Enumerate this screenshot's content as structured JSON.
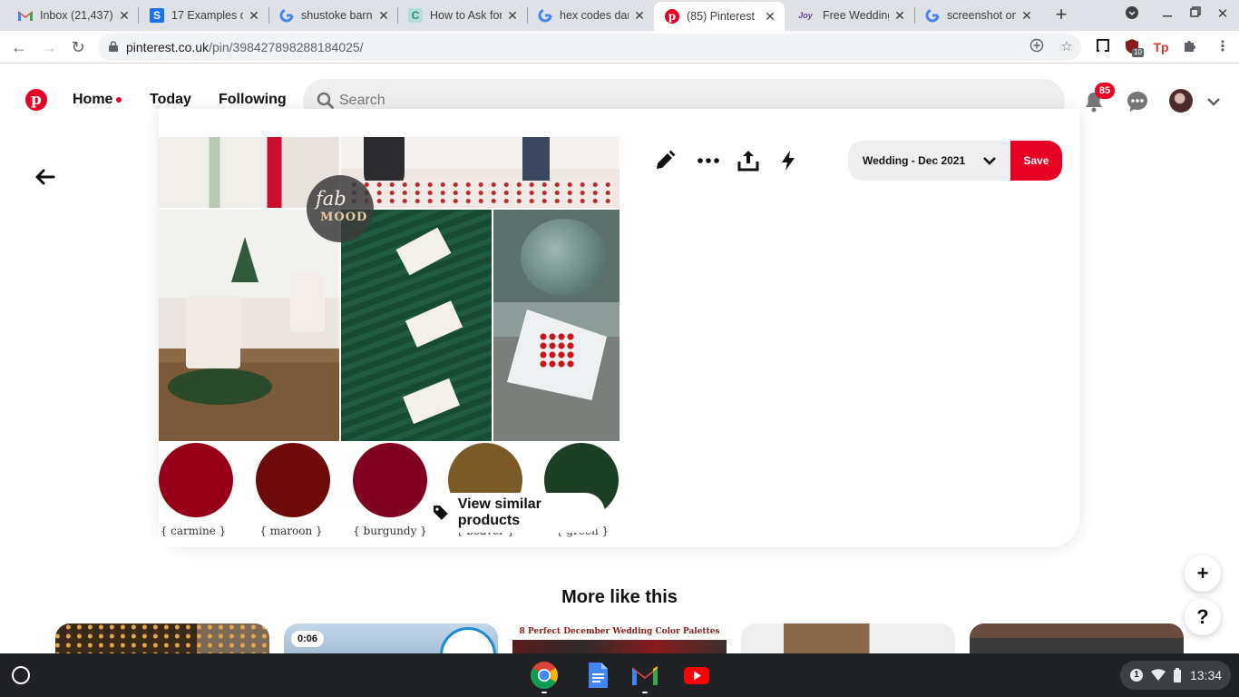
{
  "browser": {
    "tabs": [
      {
        "title": "Inbox (21,437)",
        "favicon": "gmail-icon"
      },
      {
        "title": "17 Examples o",
        "favicon": "s-icon"
      },
      {
        "title": "shustoke barn",
        "favicon": "google-icon"
      },
      {
        "title": "How to Ask for",
        "favicon": "c-icon"
      },
      {
        "title": "hex codes dark",
        "favicon": "google-icon"
      },
      {
        "title": "(85) Pinterest",
        "favicon": "pinterest-icon",
        "active": true
      },
      {
        "title": "Free Wedding",
        "favicon": "joy-icon",
        "favicon_text": "Joy"
      },
      {
        "title": "screenshot on",
        "favicon": "google-icon"
      }
    ],
    "url_host": "pinterest.co.uk",
    "url_path": "/pin/398427898288184025/",
    "extension_badge": "10"
  },
  "header": {
    "nav": {
      "home": "Home",
      "today": "Today",
      "following": "Following"
    },
    "search_placeholder": "Search",
    "notification_count": "85"
  },
  "pin": {
    "image": {
      "logo_line1": "fab",
      "logo_line2": "MOOD",
      "palette": [
        {
          "name": "{ carmine }",
          "color": "#960018"
        },
        {
          "name": "{ maroon }",
          "color": "#800000"
        },
        {
          "name": "{ burgundy }",
          "color": "#800020"
        },
        {
          "name": "{ beaver }",
          "color": "#7b5a27"
        },
        {
          "name": "{ green }",
          "color": "#1d3f25"
        }
      ],
      "view_similar_label": "View similar products"
    },
    "board_label": "Wedding - Dec 2021",
    "save_label": "Save"
  },
  "more_like_this": {
    "title": "More like this",
    "video_duration": "0:06",
    "thumb3_caption": "8 Perfect December Wedding Color Palettes"
  },
  "help_label": "?",
  "shelf": {
    "notification_count": "1",
    "time": "13:34"
  },
  "colors": {
    "pinterest_red": "#e60023",
    "shelf": "#202124"
  }
}
